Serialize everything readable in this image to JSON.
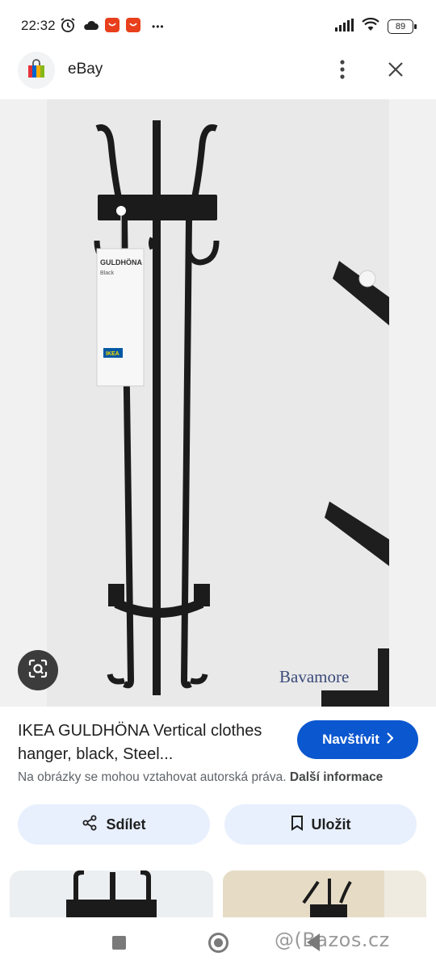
{
  "status_bar": {
    "time": "22:32",
    "battery": "89",
    "more": "•••"
  },
  "header": {
    "site_name": "eBay",
    "more_icon": "more-vert-icon",
    "close_icon": "close-icon"
  },
  "image": {
    "watermark_text": "Bavamore",
    "tag_line1": "GULDHÖNA",
    "tag_line2": "Black",
    "tag_brand": "IKEA"
  },
  "result": {
    "title": "IKEA GULDHÖNA Vertical clothes hanger, black, Steel...",
    "visit_label": "Navštívit",
    "copyright_text": "Na obrázky se mohou vztahovat autorská práva.",
    "more_info": "Další informace"
  },
  "actions": {
    "share_label": "Sdílet",
    "save_label": "Uložit"
  },
  "nav": {
    "watermark": "@(Bazos.cz"
  },
  "colors": {
    "accent": "#0b57d0",
    "pill_bg": "#e8f0fe",
    "image_bg": "#f1f1f1"
  }
}
